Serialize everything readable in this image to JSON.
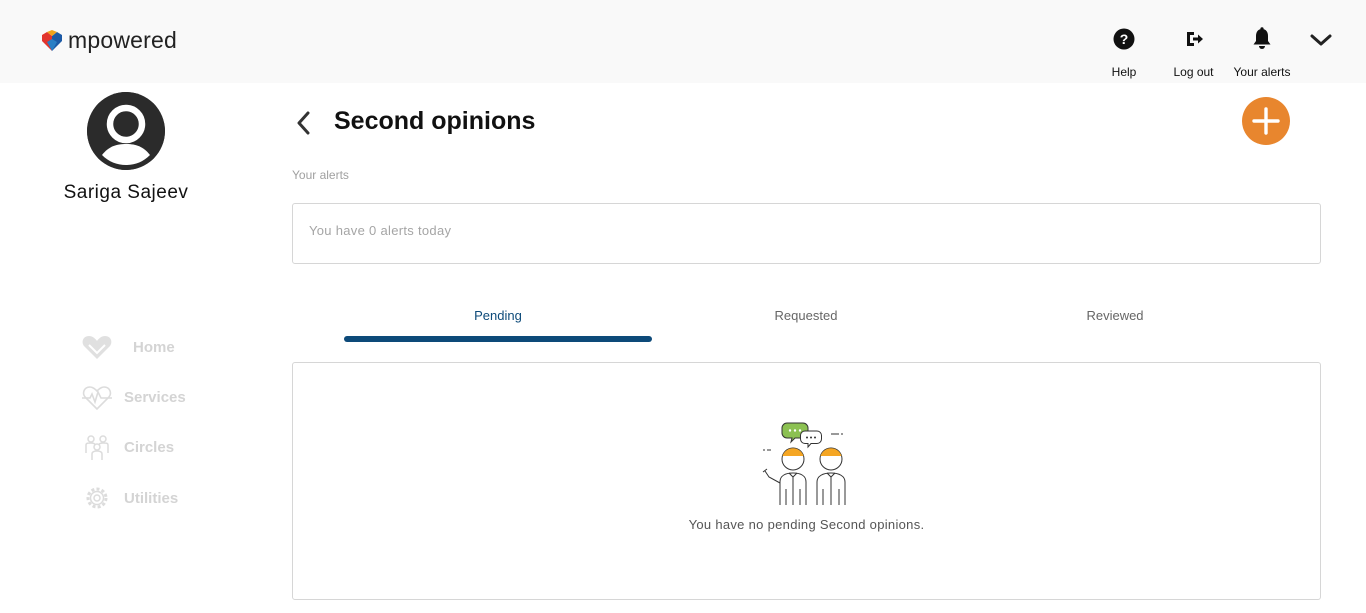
{
  "app": {
    "brand": "mpowered"
  },
  "header": {
    "actions": [
      {
        "label": "Help",
        "icon": "help-icon"
      },
      {
        "label": "Log out",
        "icon": "logout-icon"
      },
      {
        "label": "Your alerts",
        "icon": "bell-icon"
      }
    ],
    "menu_icon": "chevron-down-icon"
  },
  "user": {
    "name": "Sariga Sajeev"
  },
  "sidebar": {
    "items": [
      {
        "label": "Home",
        "icon": "heart-hands-icon"
      },
      {
        "label": "Services",
        "icon": "heartbeat-icon"
      },
      {
        "label": "Circles",
        "icon": "people-icon"
      },
      {
        "label": "Utilities",
        "icon": "gear-icon"
      }
    ]
  },
  "page": {
    "title": "Second opinions",
    "alerts_label": "Your alerts",
    "alerts_text": "You have 0 alerts today"
  },
  "tabs": [
    {
      "label": "Pending",
      "active": true
    },
    {
      "label": "Requested",
      "active": false
    },
    {
      "label": "Reviewed",
      "active": false
    }
  ],
  "empty_state": {
    "message": "You have no pending Second opinions."
  },
  "colors": {
    "accent": "#e8862e",
    "tab_active": "#0d4a79",
    "topbar_bg": "#f9f9f9",
    "sidebar_disabled": "#d4d4d4"
  }
}
